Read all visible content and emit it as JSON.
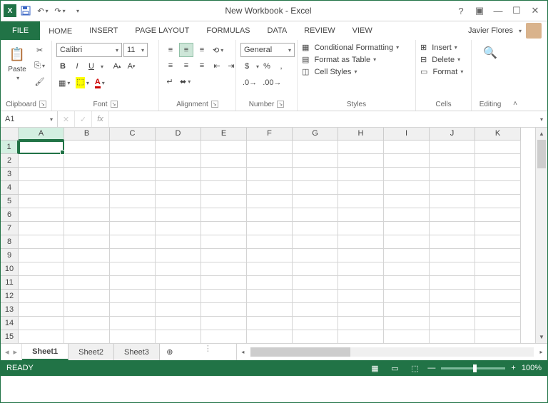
{
  "titlebar": {
    "title": "New Workbook - Excel"
  },
  "tabs": {
    "file": "FILE",
    "items": [
      "HOME",
      "INSERT",
      "PAGE LAYOUT",
      "FORMULAS",
      "DATA",
      "REVIEW",
      "VIEW"
    ],
    "active": 0
  },
  "user": {
    "name": "Javier Flores"
  },
  "ribbon": {
    "clipboard": {
      "label": "Clipboard",
      "paste": "Paste"
    },
    "font": {
      "label": "Font",
      "name": "Calibri",
      "size": "11",
      "bold": "B",
      "italic": "I",
      "underline": "U"
    },
    "alignment": {
      "label": "Alignment",
      "wrap": "Wrap Text",
      "merge": "Merge & Center"
    },
    "number": {
      "label": "Number",
      "format": "General",
      "currency": "$",
      "percent": "%",
      "comma": ",",
      "inc": ".0",
      "dec": ".00"
    },
    "styles": {
      "label": "Styles",
      "cond": "Conditional Formatting",
      "table": "Format as Table",
      "cell": "Cell Styles"
    },
    "cells": {
      "label": "Cells",
      "insert": "Insert",
      "delete": "Delete",
      "format": "Format"
    },
    "editing": {
      "label": "Editing"
    }
  },
  "namebox": {
    "value": "A1"
  },
  "formula": {
    "value": "",
    "fx": "fx"
  },
  "columns": [
    "A",
    "B",
    "C",
    "D",
    "E",
    "F",
    "G",
    "H",
    "I",
    "J",
    "K"
  ],
  "rows": [
    "1",
    "2",
    "3",
    "4",
    "5",
    "6",
    "7",
    "8",
    "9",
    "10",
    "11",
    "12",
    "13",
    "14",
    "15"
  ],
  "sheets": {
    "tabs": [
      "Sheet1",
      "Sheet2",
      "Sheet3"
    ],
    "active": 0
  },
  "status": {
    "ready": "READY",
    "zoom": "100%"
  }
}
